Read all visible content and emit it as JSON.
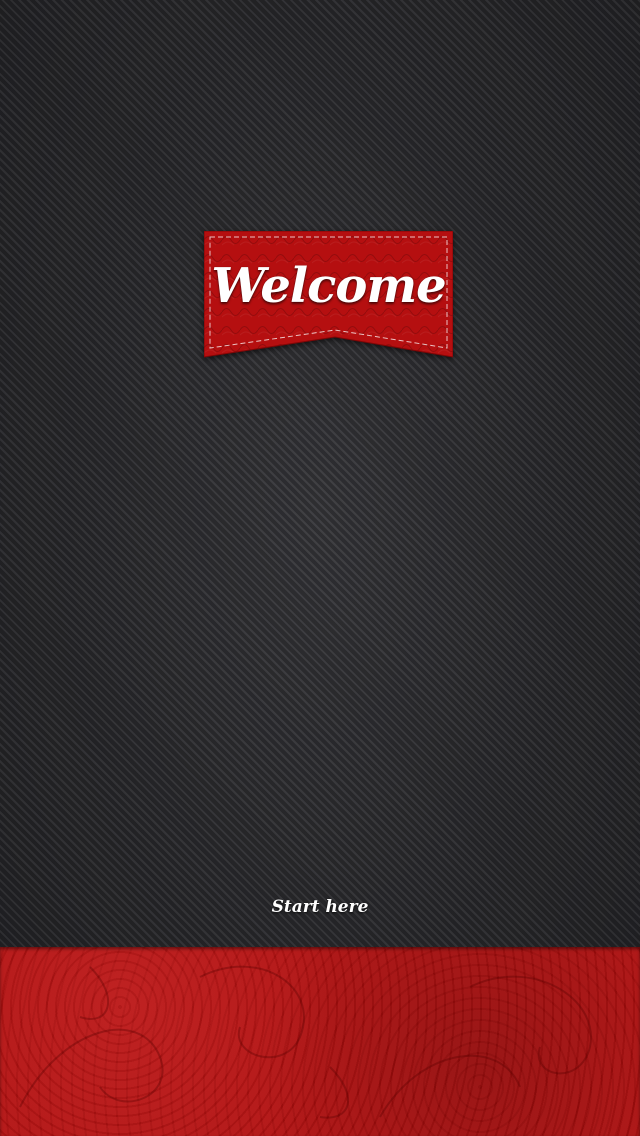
{
  "welcome_banner": {
    "title": "Welcome",
    "color": "#b50f10"
  },
  "start_link": {
    "label": "Start here"
  },
  "footer_panel": {
    "color": "#b00e0e"
  },
  "background": {
    "color": "#2a2a2d"
  }
}
